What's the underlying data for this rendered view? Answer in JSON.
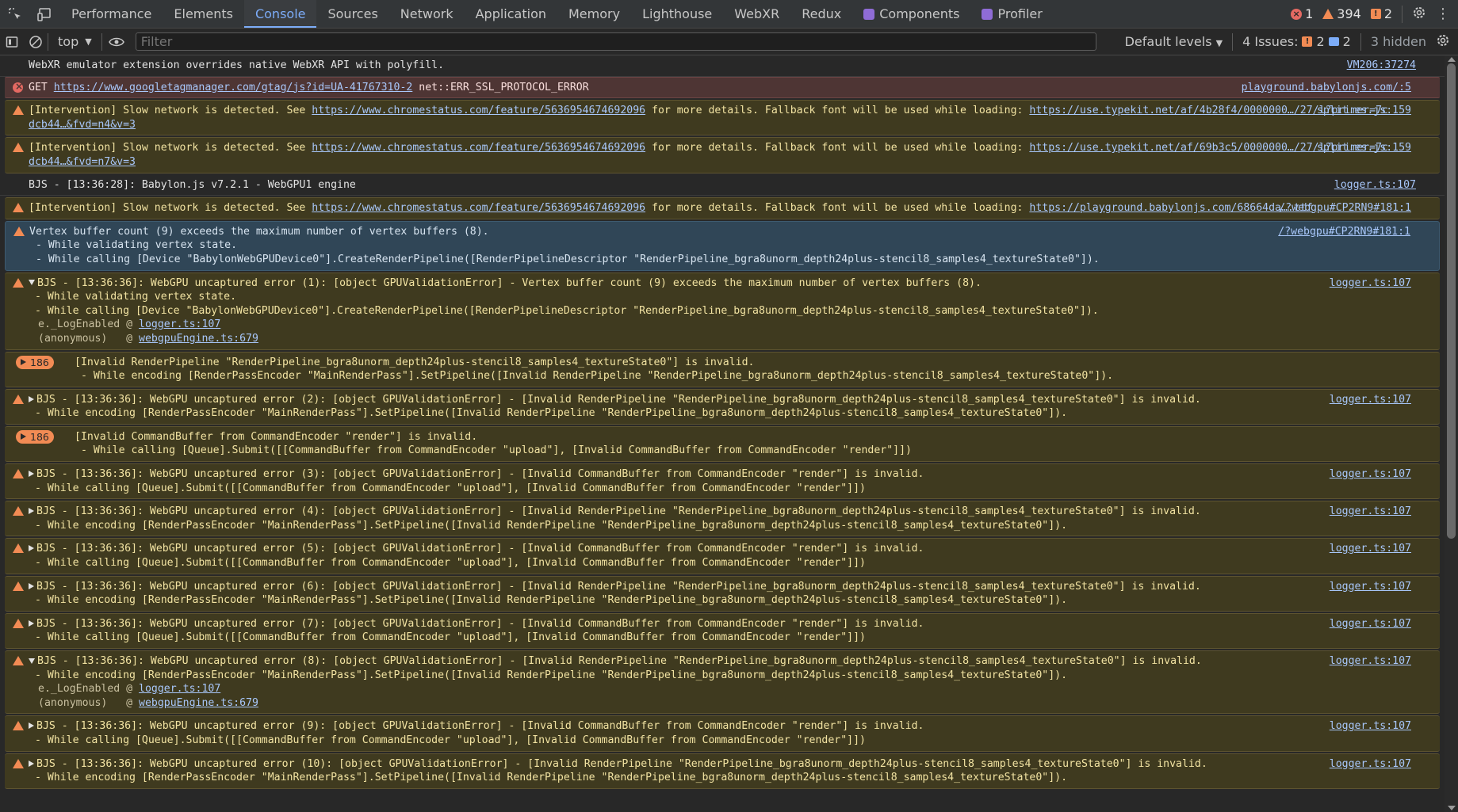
{
  "tabs": [
    "Performance",
    "Elements",
    "Console",
    "Sources",
    "Network",
    "Application",
    "Memory",
    "Lighthouse",
    "WebXR",
    "Redux",
    "Components",
    "Profiler"
  ],
  "active_tab": "Console",
  "counts": {
    "errors": "1",
    "warnings": "394",
    "issues": "2"
  },
  "toolbar": {
    "context": "top",
    "filter_placeholder": "Filter",
    "levels": "Default levels",
    "issues_label": "4 Issues:",
    "issue_warn_count": "2",
    "issue_info_count": "2",
    "hidden": "3 hidden"
  },
  "colors": {
    "accent": "#7cacf8",
    "error": "#e46962",
    "warning": "#f28b54",
    "warn_bg": "#3f3a1f",
    "error_bg": "#4e3534",
    "selected_bg": "#304657"
  },
  "messages": [
    {
      "level": "info",
      "text": "WebXR emulator extension overrides native WebXR API with polyfill.",
      "source": "VM206:37274"
    },
    {
      "level": "error",
      "prefix": "GET ",
      "link": "https://www.googletagmanager.com/gtag/js?id=UA-41767310-2",
      "suffix": " net::ERR_SSL_PROTOCOL_ERROR",
      "source": "playground.babylonjs.com/:5"
    },
    {
      "level": "warn",
      "text": "[Intervention] Slow network is detected. See ",
      "link": "https://www.chromestatus.com/feature/5636954674692096",
      "text2": " for more details. Fallback font will be used while loading: ",
      "link2": "https://use.typekit.net/af/4b28f4/0000000…/27/l?primer=7cdcb44…&fvd=n4&v=3",
      "source": "split.es.js:159"
    },
    {
      "level": "warn",
      "text": "[Intervention] Slow network is detected. See ",
      "link": "https://www.chromestatus.com/feature/5636954674692096",
      "text2": " for more details. Fallback font will be used while loading: ",
      "link2": "https://use.typekit.net/af/69b3c5/0000000…/27/l?primer=7cdcb44…&fvd=n7&v=3",
      "source": "split.es.js:159"
    },
    {
      "level": "info",
      "text": "BJS - [13:36:28]: Babylon.js v7.2.1 - WebGPU1 engine",
      "source": "logger.ts:107"
    },
    {
      "level": "warn",
      "text": "[Intervention] Slow network is detected. See ",
      "link": "https://www.chromestatus.com/feature/5636954674692096",
      "text2": " for more details. Fallback font will be used while loading: ",
      "link2": "https://playground.babylonjs.com/68664da….ttf",
      "source": "/?webgpu#CP2RN9#181:1"
    },
    {
      "level": "warn-sel",
      "text": "Vertex buffer count (9) exceeds the maximum number of vertex buffers (8).\n - While validating vertex state.\n - While calling [Device \"BabylonWebGPUDevice0\"].CreateRenderPipeline([RenderPipelineDescriptor \"RenderPipeline_bgra8unorm_depth24plus-stencil8_samples4_textureState0\"]).",
      "source": "/?webgpu#CP2RN9#181:1"
    },
    {
      "level": "warn",
      "open": true,
      "text": "BJS - [13:36:36]: WebGPU uncaptured error (1): [object GPUValidationError] - Vertex buffer count (9) exceeds the maximum number of vertex buffers (8).\n - While validating vertex state.\n - While calling [Device \"BabylonWebGPUDevice0\"].CreateRenderPipeline([RenderPipelineDescriptor \"RenderPipeline_bgra8unorm_depth24plus-stencil8_samples4_textureState0\"]).",
      "stack": [
        {
          "fn": "e._LogEnabled @ ",
          "link": "logger.ts:107"
        },
        {
          "fn": "(anonymous)   @ ",
          "link": "webgpuEngine.ts:679"
        }
      ],
      "source": "logger.ts:107"
    },
    {
      "level": "warn",
      "group": "186",
      "text": "[Invalid RenderPipeline \"RenderPipeline_bgra8unorm_depth24plus-stencil8_samples4_textureState0\"] is invalid.\n - While encoding [RenderPassEncoder \"MainRenderPass\"].SetPipeline([Invalid RenderPipeline \"RenderPipeline_bgra8unorm_depth24plus-stencil8_samples4_textureState0\"]).",
      "source": ""
    },
    {
      "level": "warn",
      "closed": true,
      "text": "BJS - [13:36:36]: WebGPU uncaptured error (2): [object GPUValidationError] - [Invalid RenderPipeline \"RenderPipeline_bgra8unorm_depth24plus-stencil8_samples4_textureState0\"] is invalid.\n - While encoding [RenderPassEncoder \"MainRenderPass\"].SetPipeline([Invalid RenderPipeline \"RenderPipeline_bgra8unorm_depth24plus-stencil8_samples4_textureState0\"]).",
      "source": "logger.ts:107"
    },
    {
      "level": "warn",
      "group": "186",
      "text": "[Invalid CommandBuffer from CommandEncoder \"render\"] is invalid.\n - While calling [Queue].Submit([[CommandBuffer from CommandEncoder \"upload\"], [Invalid CommandBuffer from CommandEncoder \"render\"]])",
      "source": ""
    },
    {
      "level": "warn",
      "closed": true,
      "text": "BJS - [13:36:36]: WebGPU uncaptured error (3): [object GPUValidationError] - [Invalid CommandBuffer from CommandEncoder \"render\"] is invalid.\n - While calling [Queue].Submit([[CommandBuffer from CommandEncoder \"upload\"], [Invalid CommandBuffer from CommandEncoder \"render\"]])",
      "source": "logger.ts:107"
    },
    {
      "level": "warn",
      "closed": true,
      "text": "BJS - [13:36:36]: WebGPU uncaptured error (4): [object GPUValidationError] - [Invalid RenderPipeline \"RenderPipeline_bgra8unorm_depth24plus-stencil8_samples4_textureState0\"] is invalid.\n - While encoding [RenderPassEncoder \"MainRenderPass\"].SetPipeline([Invalid RenderPipeline \"RenderPipeline_bgra8unorm_depth24plus-stencil8_samples4_textureState0\"]).",
      "source": "logger.ts:107"
    },
    {
      "level": "warn",
      "closed": true,
      "text": "BJS - [13:36:36]: WebGPU uncaptured error (5): [object GPUValidationError] - [Invalid CommandBuffer from CommandEncoder \"render\"] is invalid.\n - While calling [Queue].Submit([[CommandBuffer from CommandEncoder \"upload\"], [Invalid CommandBuffer from CommandEncoder \"render\"]])",
      "source": "logger.ts:107"
    },
    {
      "level": "warn",
      "closed": true,
      "text": "BJS - [13:36:36]: WebGPU uncaptured error (6): [object GPUValidationError] - [Invalid RenderPipeline \"RenderPipeline_bgra8unorm_depth24plus-stencil8_samples4_textureState0\"] is invalid.\n - While encoding [RenderPassEncoder \"MainRenderPass\"].SetPipeline([Invalid RenderPipeline \"RenderPipeline_bgra8unorm_depth24plus-stencil8_samples4_textureState0\"]).",
      "source": "logger.ts:107"
    },
    {
      "level": "warn",
      "closed": true,
      "text": "BJS - [13:36:36]: WebGPU uncaptured error (7): [object GPUValidationError] - [Invalid CommandBuffer from CommandEncoder \"render\"] is invalid.\n - While calling [Queue].Submit([[CommandBuffer from CommandEncoder \"upload\"], [Invalid CommandBuffer from CommandEncoder \"render\"]])",
      "source": "logger.ts:107"
    },
    {
      "level": "warn",
      "open": true,
      "text": "BJS - [13:36:36]: WebGPU uncaptured error (8): [object GPUValidationError] - [Invalid RenderPipeline \"RenderPipeline_bgra8unorm_depth24plus-stencil8_samples4_textureState0\"] is invalid.\n - While encoding [RenderPassEncoder \"MainRenderPass\"].SetPipeline([Invalid RenderPipeline \"RenderPipeline_bgra8unorm_depth24plus-stencil8_samples4_textureState0\"]).",
      "stack": [
        {
          "fn": "e._LogEnabled @ ",
          "link": "logger.ts:107"
        },
        {
          "fn": "(anonymous)   @ ",
          "link": "webgpuEngine.ts:679"
        }
      ],
      "source": "logger.ts:107"
    },
    {
      "level": "warn",
      "closed": true,
      "text": "BJS - [13:36:36]: WebGPU uncaptured error (9): [object GPUValidationError] - [Invalid CommandBuffer from CommandEncoder \"render\"] is invalid.\n - While calling [Queue].Submit([[CommandBuffer from CommandEncoder \"upload\"], [Invalid CommandBuffer from CommandEncoder \"render\"]])",
      "source": "logger.ts:107"
    },
    {
      "level": "warn",
      "closed": true,
      "text": "BJS - [13:36:36]: WebGPU uncaptured error (10): [object GPUValidationError] - [Invalid RenderPipeline \"RenderPipeline_bgra8unorm_depth24plus-stencil8_samples4_textureState0\"] is invalid.\n - While encoding [RenderPassEncoder \"MainRenderPass\"].SetPipeline([Invalid RenderPipeline \"RenderPipeline_bgra8unorm_depth24plus-stencil8_samples4_textureState0\"]).",
      "source": "logger.ts:107"
    }
  ]
}
